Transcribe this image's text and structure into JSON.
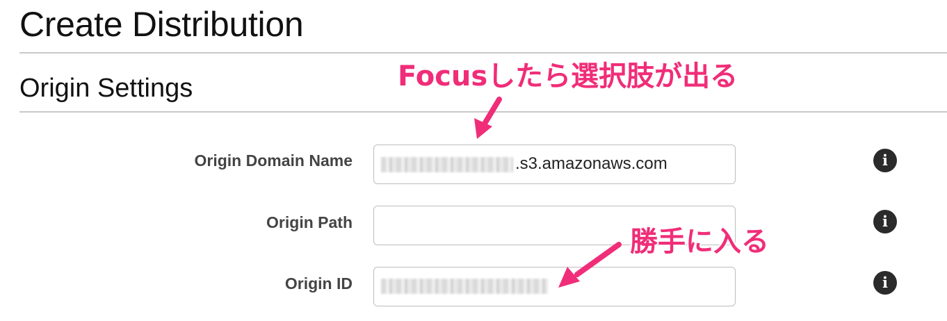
{
  "page": {
    "title": "Create Distribution",
    "section_title": "Origin Settings"
  },
  "fields": [
    {
      "label": "Origin Domain Name",
      "value_suffix": ".s3.amazonaws.com",
      "info_icon": "info-icon"
    },
    {
      "label": "Origin Path",
      "value": "",
      "info_icon": "info-icon"
    },
    {
      "label": "Origin ID",
      "info_icon": "info-icon"
    }
  ],
  "annotations": {
    "focus_note": "Focusしたら選択肢が出る",
    "auto_note": "勝手に入る",
    "color": "#f02d78"
  }
}
